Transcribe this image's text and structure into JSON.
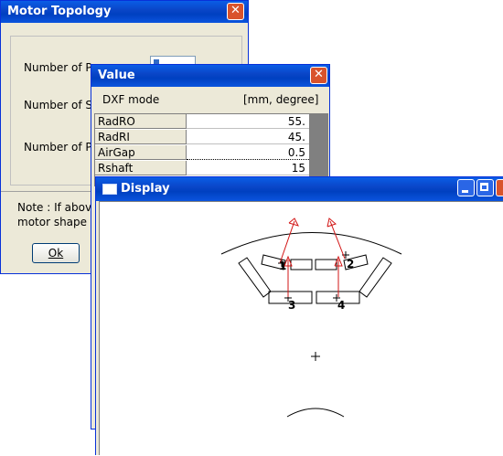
{
  "motor_topology": {
    "title": "Motor Topology",
    "close_glyph": "✕",
    "labels": [
      "Number of Po",
      "Number of Sl",
      "Number of Ph"
    ],
    "note_line1": "Note : If above",
    "note_line2": "motor shape va",
    "ok_label": "Ok"
  },
  "value_window": {
    "title": "Value",
    "close_glyph": "✕",
    "mode_label": "DXF mode",
    "units_label": "[mm, degree]",
    "rows": [
      {
        "name": "RadRO",
        "value": "55."
      },
      {
        "name": "RadRI",
        "value": "45."
      },
      {
        "name": "AirGap",
        "value": "0.5"
      },
      {
        "name": "Rshaft",
        "value": "15"
      }
    ]
  },
  "display_window": {
    "title": "Display",
    "markers": [
      "1",
      "2",
      "3",
      "4"
    ],
    "center_mark": "+"
  },
  "colors": {
    "title_blue": "#0a46c8",
    "window_face": "#ece9d8",
    "arrow_red": "#d21414"
  }
}
